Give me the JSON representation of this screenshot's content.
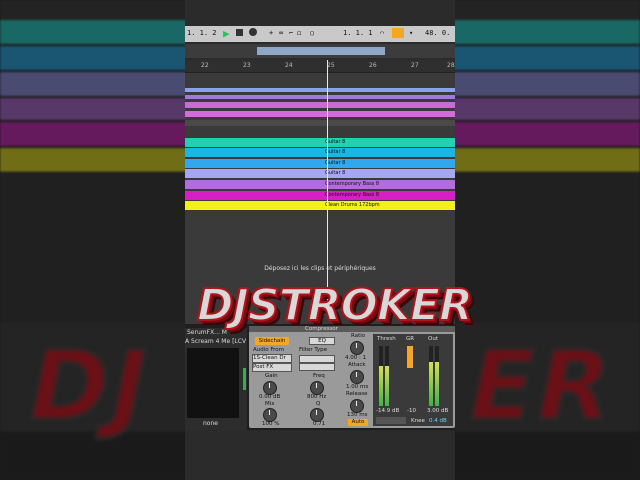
{
  "transport": {
    "position": "1. 1. 2",
    "position2": "1. 1. 1",
    "position3": "48. 0."
  },
  "ruler": {
    "bars": [
      "22",
      "23",
      "24",
      "25",
      "26",
      "27",
      "28"
    ]
  },
  "clips": [
    {
      "label": "Guitar 8",
      "color": "#1dd3b0"
    },
    {
      "label": "Guitar 8",
      "color": "#19b6e6"
    },
    {
      "label": "Guitar 8",
      "color": "#2fa8ef"
    },
    {
      "label": "Guitar 8",
      "color": "#a7a6f2"
    },
    {
      "label": "Contemporary Bass 8",
      "color": "#b26be0"
    },
    {
      "label": "Contemporary Bass 8",
      "color": "#d81fc6"
    },
    {
      "label": "Clean Drums 172bpm",
      "color": "#f4f01a"
    }
  ],
  "arrangement": {
    "drop_text": "Déposez ici les clips et périphériques"
  },
  "left_device": {
    "name": "SerumFX... M",
    "preset": "A Scream 4 Me [LCV",
    "none_label": "none"
  },
  "compressor": {
    "title": "Compressor",
    "sidechain_label": "Sidechain",
    "eq_label": "EQ",
    "audio_from_label": "Audio From",
    "audio_from_value": "1S-Clean Dr",
    "post_fx": "Post FX",
    "filter_type_label": "Filter Type",
    "gain_label": "Gain",
    "gain_value": "0.00 dB",
    "mix_label": "Mix",
    "mix_value": "100 %",
    "freq_label": "Freq",
    "freq_value": "800 Hz",
    "q_label": "Q",
    "q_value": "0.71",
    "ratio_label": "Ratio",
    "ratio_value": "4.00 : 1",
    "attack_label": "Attack",
    "attack_value": "1.00 ms",
    "release_label": "Release",
    "release_value": "130 ms",
    "auto_label": "Auto",
    "thresh_label": "Thresh",
    "gr_label": "GR",
    "out_label": "Out",
    "thresh_value": "-14.9 dB",
    "gr_value": "-10",
    "out_value": "3.00 dB",
    "knee_label": "Knee",
    "knee_value": "0.4 dB"
  },
  "logo": {
    "text": "DJSTROKER"
  },
  "colors": {
    "accent": "#f5a623",
    "play": "#22c55e",
    "logo_red": "#b0141c"
  }
}
